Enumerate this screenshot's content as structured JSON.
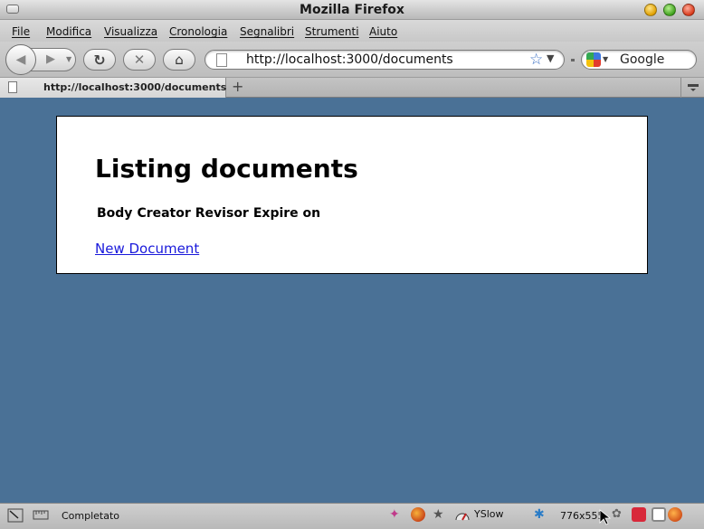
{
  "window": {
    "title": "Mozilla Firefox"
  },
  "menu": [
    "File",
    "Modifica",
    "Visualizza",
    "Cronologia",
    "Segnalibri",
    "Strumenti",
    "Aiuto"
  ],
  "navigation": {
    "url": "http://localhost:3000/documents",
    "search_engine": "Google"
  },
  "tab": {
    "label": "http://localhost:3000/documents",
    "new_tab": "+"
  },
  "page": {
    "title": "Listing documents",
    "columns": [
      "Body",
      "Creator",
      "Revisor",
      "Expire on"
    ],
    "new_link": "New Document"
  },
  "status": {
    "text": "Completato",
    "yslow": "YSlow",
    "dimensions": "776x555"
  },
  "colors": {
    "page_background": "#4a7196",
    "link": "#1a1adb"
  }
}
